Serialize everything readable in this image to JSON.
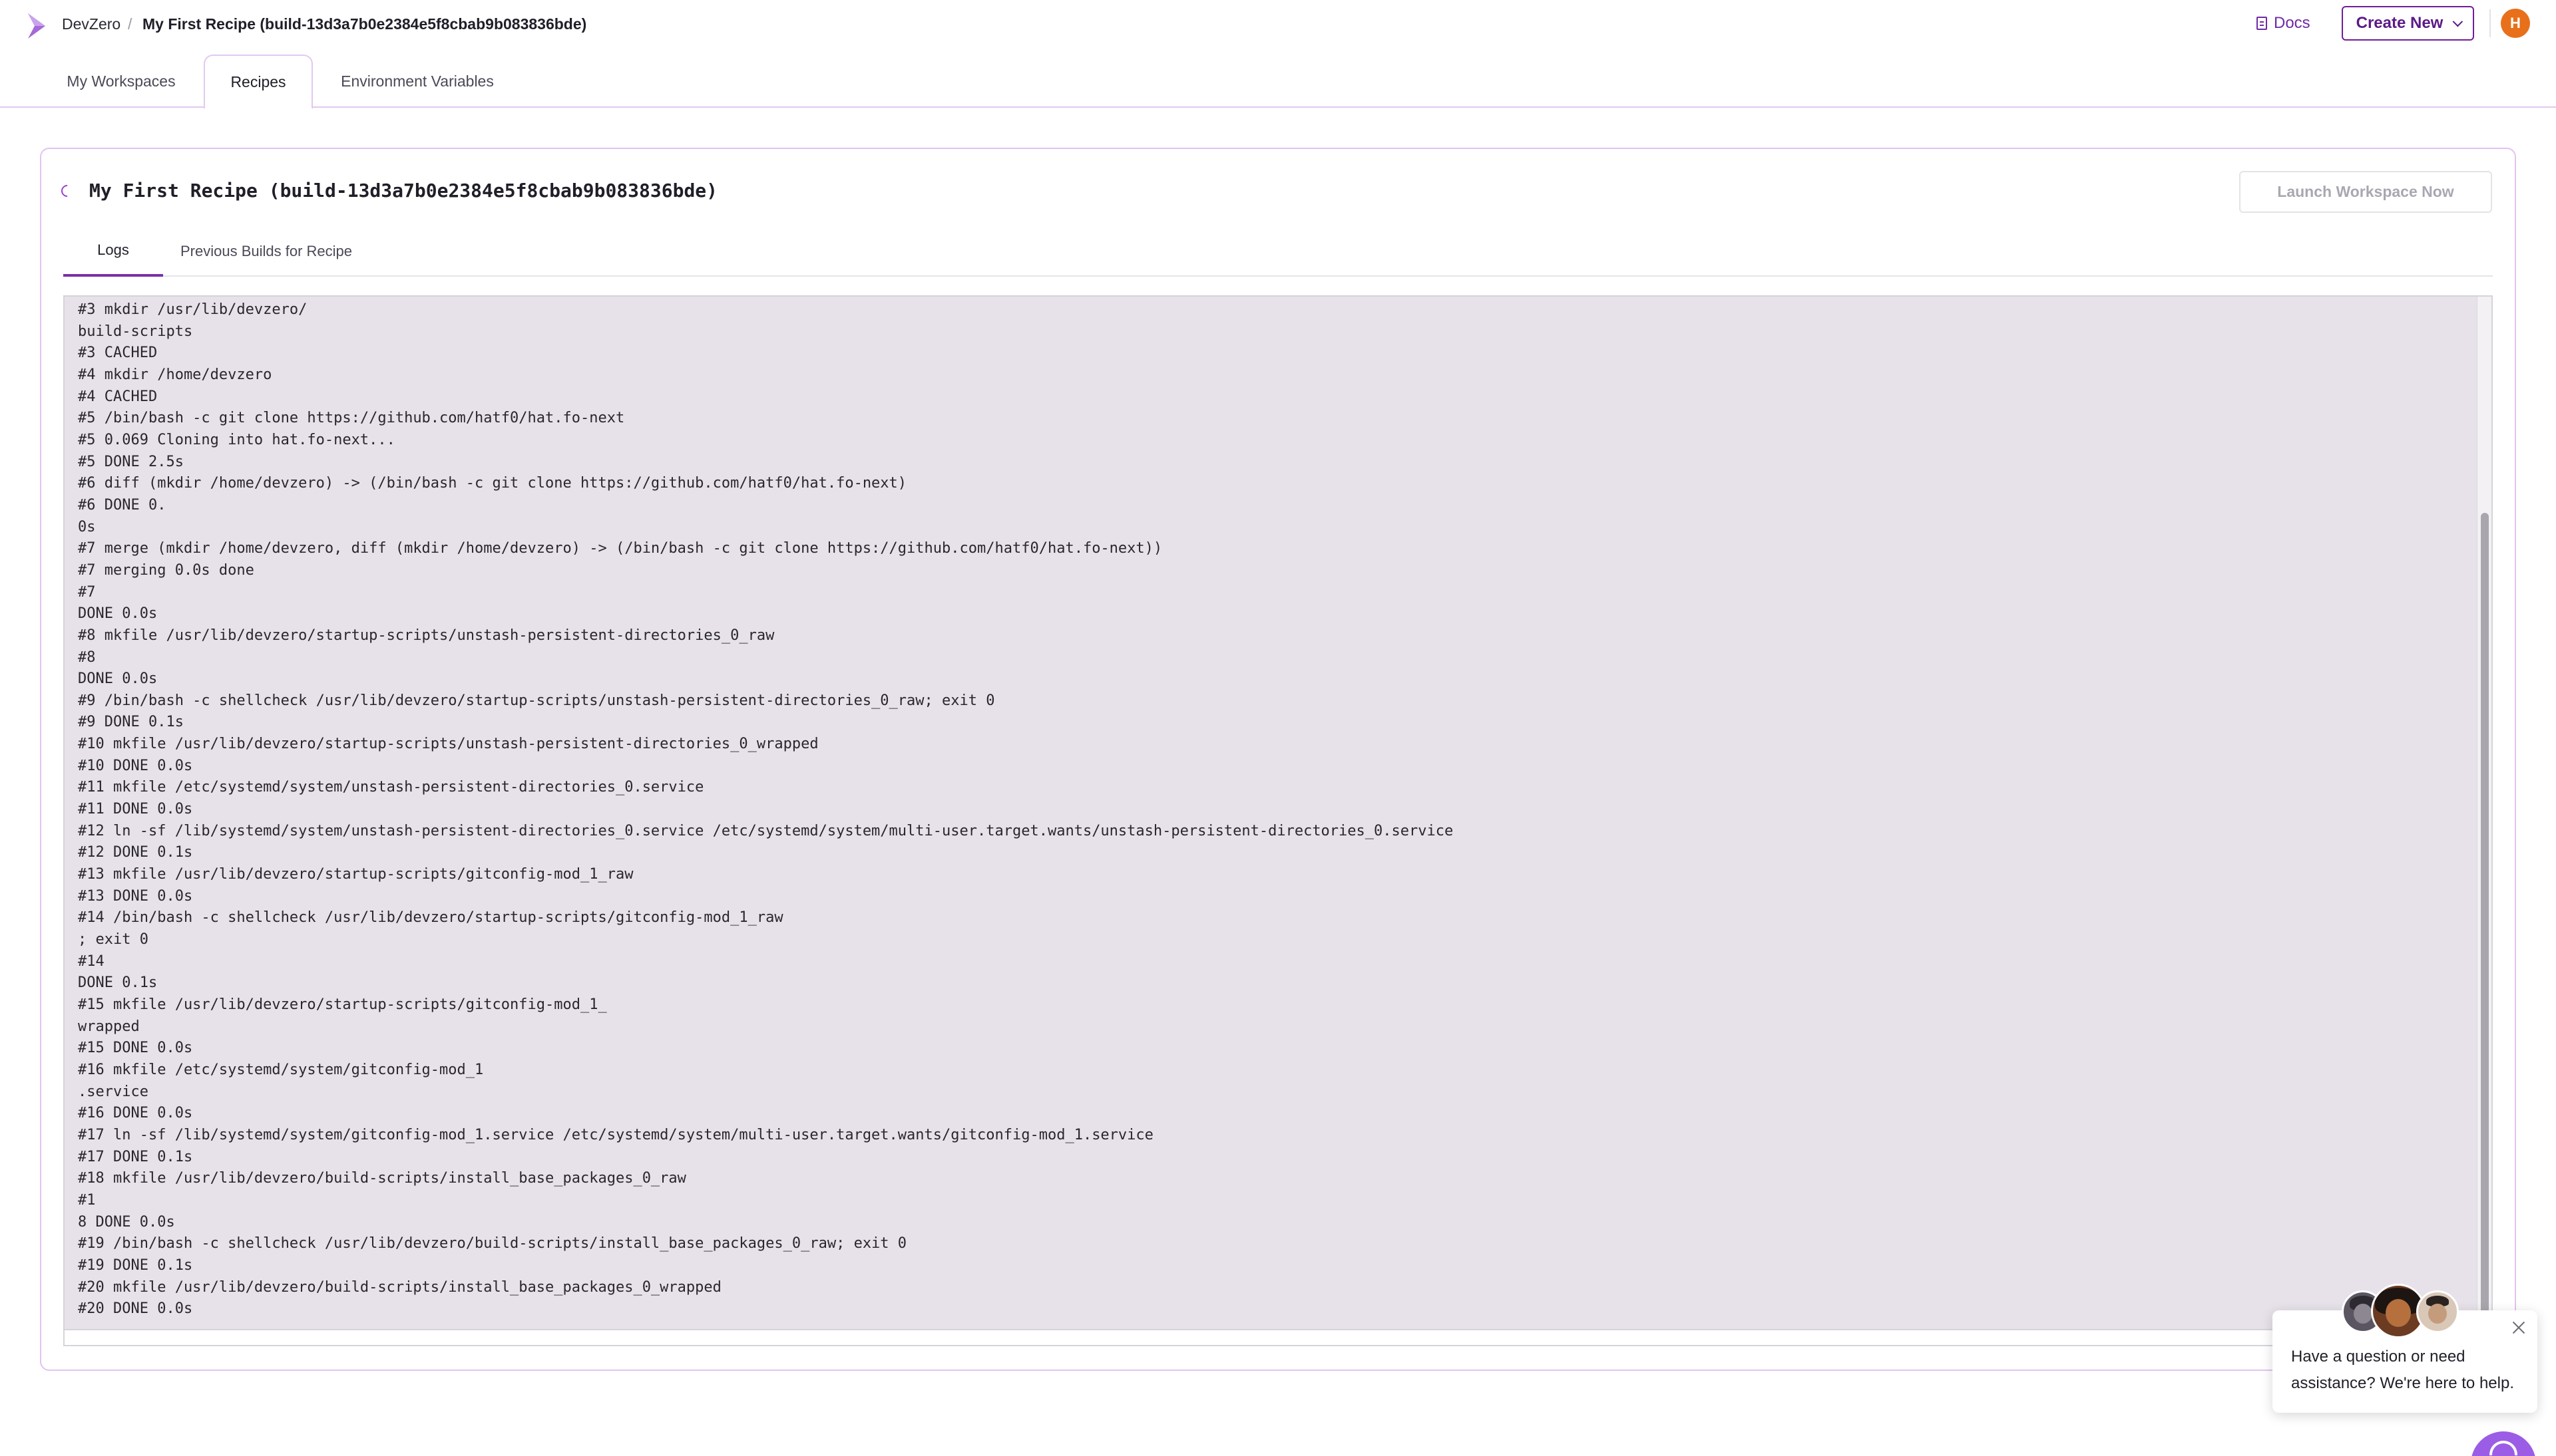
{
  "header": {
    "breadcrumb_root": "DevZero",
    "breadcrumb_separator": "/",
    "breadcrumb_current": "My First Recipe (build-13d3a7b0e2384e5f8cbab9b083836bde)",
    "docs_label": "Docs",
    "create_new_label": "Create New",
    "user_initial": "H",
    "accent_color": "#6f1e98",
    "avatar_color": "#e8701a"
  },
  "nav": {
    "tabs": [
      {
        "label": "My Workspaces",
        "active": false
      },
      {
        "label": "Recipes",
        "active": true
      },
      {
        "label": "Environment Variables",
        "active": false
      }
    ]
  },
  "recipe": {
    "title": "My First Recipe (build-13d3a7b0e2384e5f8cbab9b083836bde)",
    "status_icon": "loading-spinner-icon",
    "launch_label": "Launch Workspace Now",
    "tabs": [
      {
        "label": "Logs",
        "active": true
      },
      {
        "label": "Previous Builds for Recipe",
        "active": false
      }
    ]
  },
  "logs": {
    "lines": [
      "#3 mkdir /usr/lib/devzero/",
      "build-scripts",
      "#3 CACHED",
      "#4 mkdir /home/devzero",
      "#4 CACHED",
      "#5 /bin/bash -c git clone https://github.com/hatf0/hat.fo-next",
      "#5 0.069 Cloning into hat.fo-next...",
      "#5 DONE 2.5s",
      "#6 diff (mkdir /home/devzero) -> (/bin/bash -c git clone https://github.com/hatf0/hat.fo-next)",
      "#6 DONE 0.",
      "0s",
      "#7 merge (mkdir /home/devzero, diff (mkdir /home/devzero) -> (/bin/bash -c git clone https://github.com/hatf0/hat.fo-next))",
      "#7 merging 0.0s done",
      "#7",
      "DONE 0.0s",
      "#8 mkfile /usr/lib/devzero/startup-scripts/unstash-persistent-directories_0_raw",
      "#8",
      "DONE 0.0s",
      "#9 /bin/bash -c shellcheck /usr/lib/devzero/startup-scripts/unstash-persistent-directories_0_raw; exit 0",
      "#9 DONE 0.1s",
      "#10 mkfile /usr/lib/devzero/startup-scripts/unstash-persistent-directories_0_wrapped",
      "#10 DONE 0.0s",
      "#11 mkfile /etc/systemd/system/unstash-persistent-directories_0.service",
      "#11 DONE 0.0s",
      "#12 ln -sf /lib/systemd/system/unstash-persistent-directories_0.service /etc/systemd/system/multi-user.target.wants/unstash-persistent-directories_0.service",
      "#12 DONE 0.1s",
      "#13 mkfile /usr/lib/devzero/startup-scripts/gitconfig-mod_1_raw",
      "#13 DONE 0.0s",
      "#14 /bin/bash -c shellcheck /usr/lib/devzero/startup-scripts/gitconfig-mod_1_raw",
      "; exit 0",
      "#14",
      "DONE 0.1s",
      "#15 mkfile /usr/lib/devzero/startup-scripts/gitconfig-mod_1_",
      "wrapped",
      "#15 DONE 0.0s",
      "#16 mkfile /etc/systemd/system/gitconfig-mod_1",
      ".service",
      "#16 DONE 0.0s",
      "#17 ln -sf /lib/systemd/system/gitconfig-mod_1.service /etc/systemd/system/multi-user.target.wants/gitconfig-mod_1.service",
      "#17 DONE 0.1s",
      "#18 mkfile /usr/lib/devzero/build-scripts/install_base_packages_0_raw",
      "#1",
      "8 DONE 0.0s",
      "#19 /bin/bash -c shellcheck /usr/lib/devzero/build-scripts/install_base_packages_0_raw; exit 0",
      "#19 DONE 0.1s",
      "#20 mkfile /usr/lib/devzero/build-scripts/install_base_packages_0_wrapped",
      "#20 DONE 0.0s"
    ]
  },
  "chat": {
    "message": "Have a question or need assistance? We're here to help.",
    "launcher_color": "#9b5de5"
  }
}
